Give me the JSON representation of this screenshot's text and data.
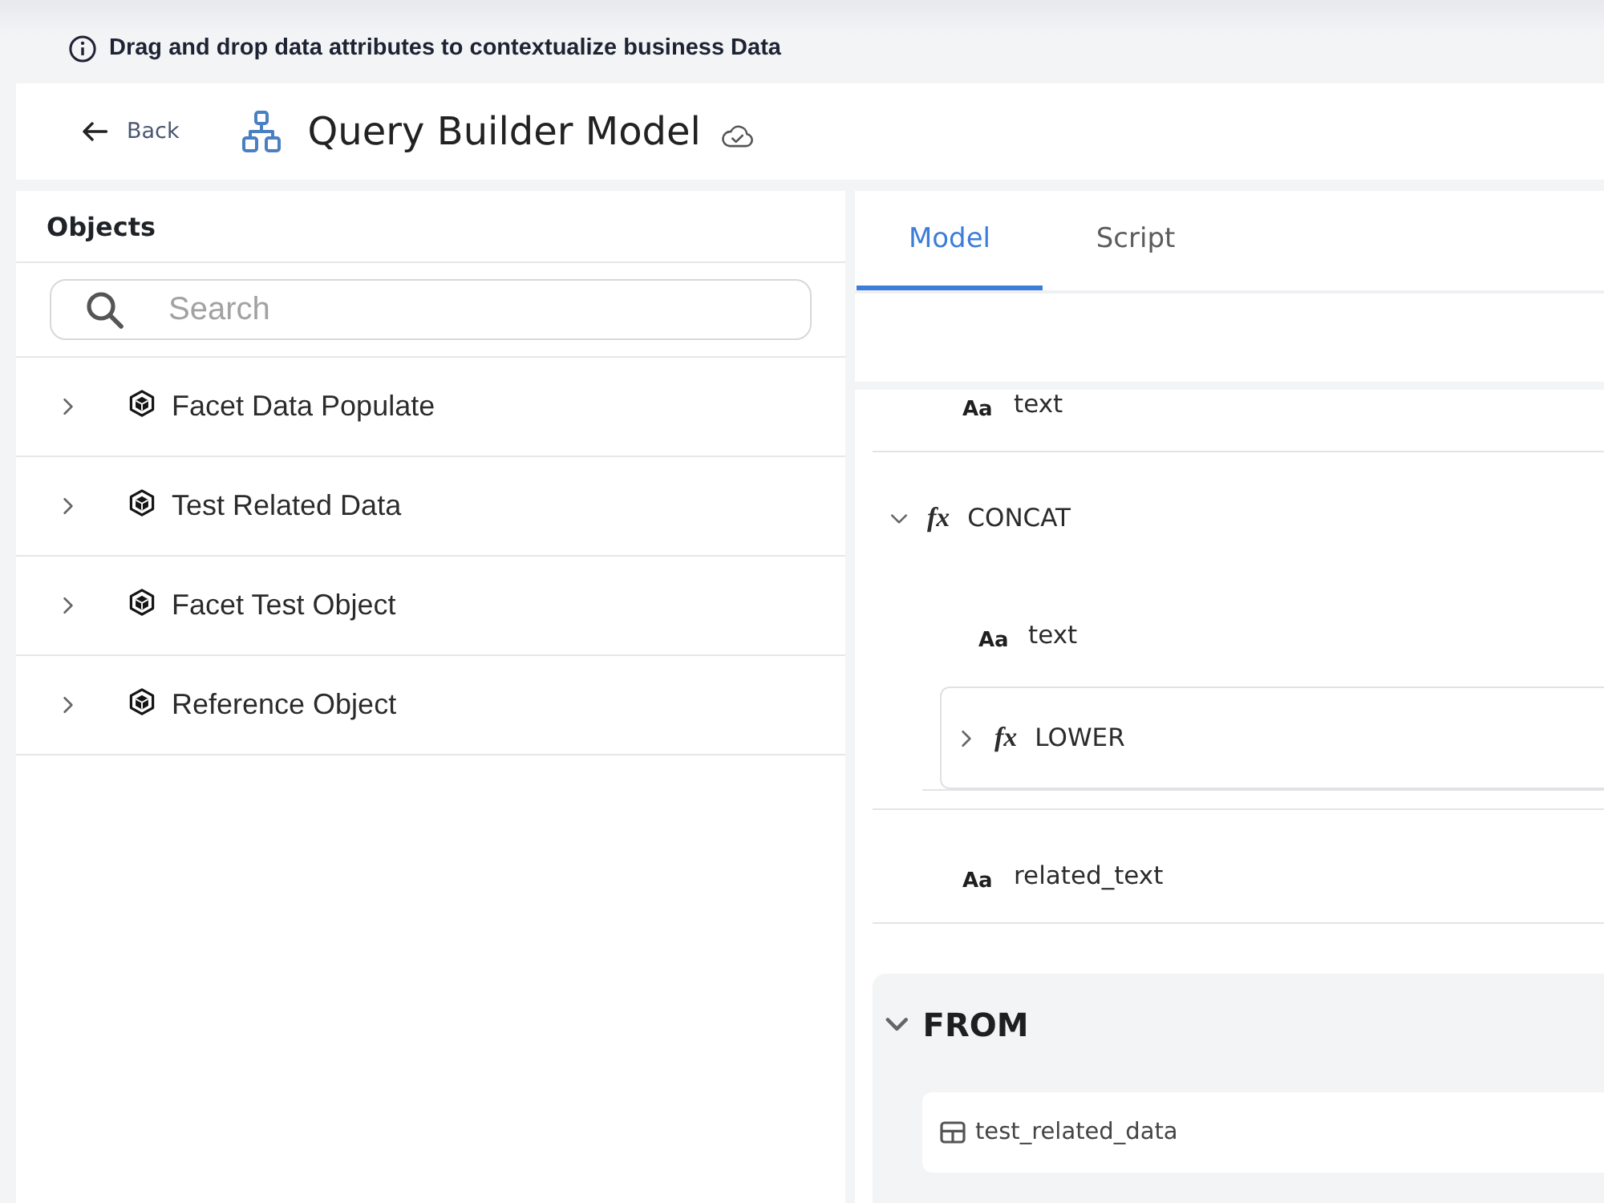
{
  "notice": {
    "text": "Drag and drop data attributes to contextualize business Data"
  },
  "header": {
    "back_label": "Back",
    "title": "Query Builder Model"
  },
  "objects_panel": {
    "title": "Objects",
    "search": {
      "placeholder": "Search"
    },
    "items": [
      {
        "label": "Facet Data Populate",
        "expanded": false
      },
      {
        "label": "Test Related Data",
        "expanded": false
      },
      {
        "label": "Facet Test Object",
        "expanded": false
      },
      {
        "label": "Reference Object",
        "expanded": false
      }
    ]
  },
  "tabs": [
    {
      "label": "Model",
      "selected": true
    },
    {
      "label": "Script",
      "selected": false
    }
  ],
  "select_items": [
    {
      "kind": "field",
      "badge": "Aa",
      "label": "text"
    },
    {
      "kind": "function",
      "badge": "fx",
      "label": "CONCAT",
      "expanded": true,
      "children": [
        {
          "kind": "field",
          "badge": "Aa",
          "label": "text"
        },
        {
          "kind": "function",
          "badge": "fx",
          "label": "LOWER",
          "expanded": false
        }
      ]
    },
    {
      "kind": "field",
      "badge": "Aa",
      "label": "related_text"
    }
  ],
  "from_section": {
    "title": "FROM",
    "expanded": true,
    "tables": [
      {
        "label": "test_related_data"
      }
    ]
  }
}
